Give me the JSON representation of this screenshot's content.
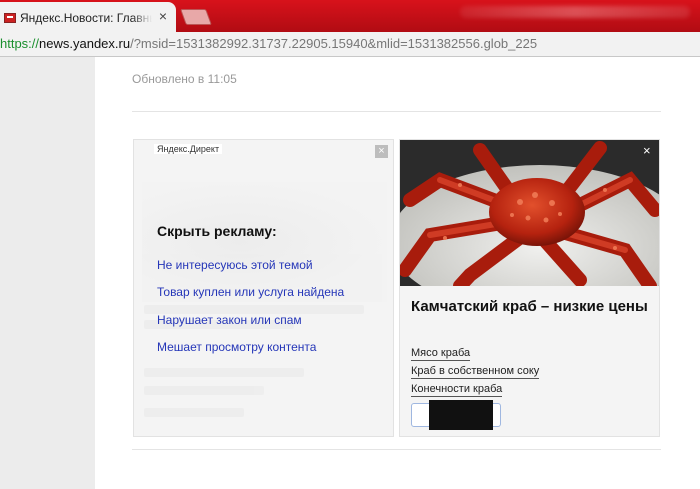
{
  "browser": {
    "tab_title": "Яндекс.Новости: Главные",
    "tab_close": "×",
    "url_scheme": "https://",
    "url_domain": "news.yandex.ru",
    "url_rest": "/?msid=1531382992.31737.22905.15940&mlid=1531382556.glob_225"
  },
  "page": {
    "updated": "Обновлено в 11:05"
  },
  "hidden_ad": {
    "direct_label": "Яндекс.Директ",
    "close": "×",
    "title": "Скрыть рекламу:",
    "reasons": [
      "Не интересуюсь этой темой",
      "Товар куплен или услуга найдена",
      "Нарушает закон или спам",
      "Мешает просмотру контента"
    ]
  },
  "crab_ad": {
    "close": "×",
    "title": "Камчатский краб – низкие цены",
    "links": [
      "Мясо краба",
      "Краб в собственном соку",
      "Конечности краба"
    ]
  },
  "icons": {
    "favicon": "yandex-news-favicon",
    "ad_close": "close-icon"
  },
  "colors": {
    "tabbar": "#c80f18",
    "link_blue": "#2536b8",
    "url_scheme": "#1a8f2e"
  }
}
